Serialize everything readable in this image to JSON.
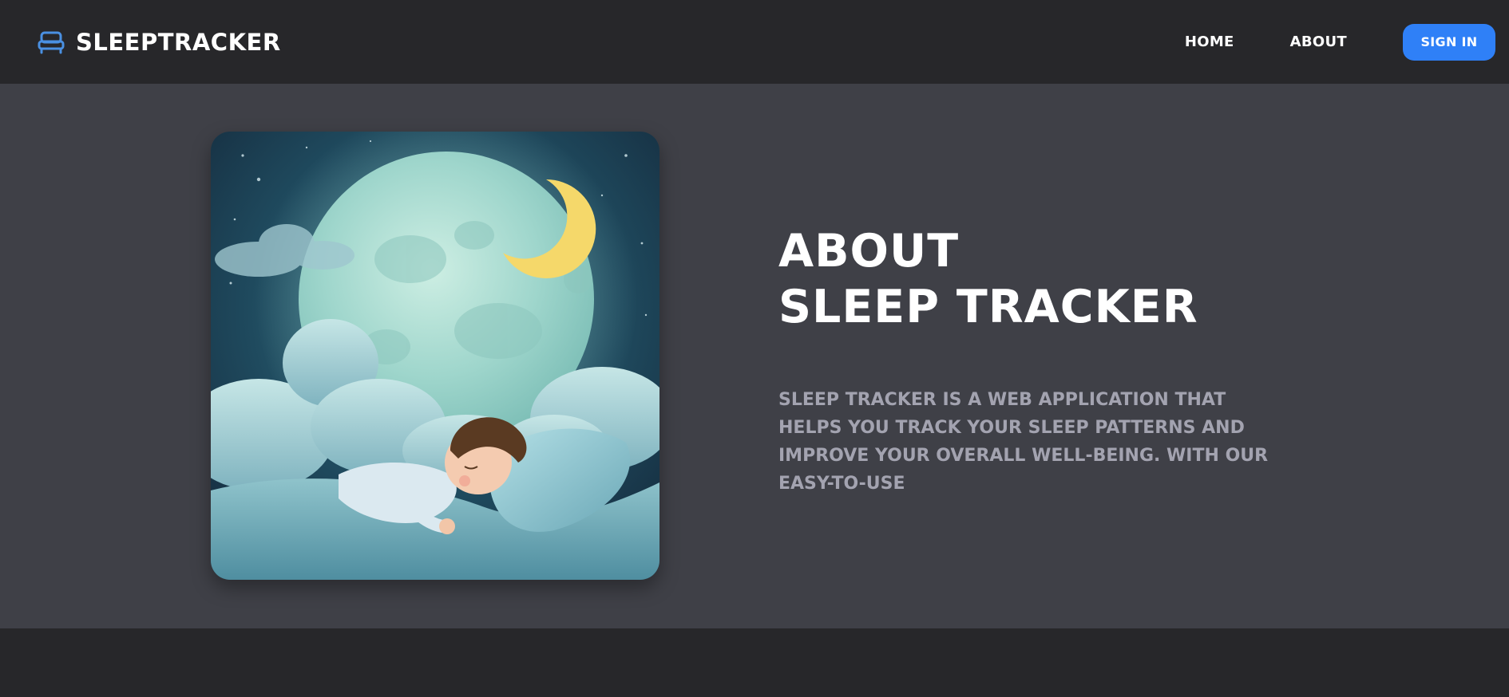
{
  "header": {
    "brand_icon": "bed-icon",
    "brand_name": "SleepTracker",
    "nav": [
      {
        "label": "Home"
      },
      {
        "label": "About"
      }
    ],
    "signin_label": "Sign In"
  },
  "hero": {
    "image_subject": "child-sleeping-under-moon",
    "title_line1": "About",
    "title_line2": "Sleep Tracker",
    "description": "Sleep Tracker is a web application that helps you track your sleep patterns and improve your overall well-being. With our easy-to-use"
  },
  "colors": {
    "header_bg": "#27272a",
    "main_bg": "#3f4047",
    "accent": "#2f80f7",
    "brand_icon": "#4a90e2",
    "title_text": "#ffffff",
    "muted_text": "#a3a3b0"
  }
}
